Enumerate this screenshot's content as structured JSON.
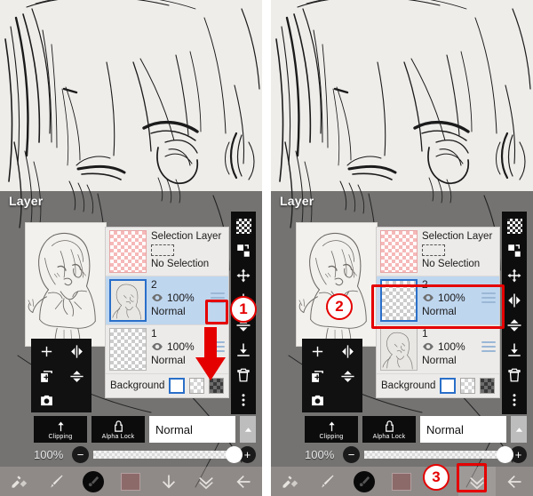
{
  "app": {
    "panel_title": "Layer"
  },
  "layer_panel": {
    "selection_layer": {
      "title": "Selection Layer",
      "status": "No Selection",
      "thumb": "pink-checker"
    },
    "rows_left": [
      {
        "name": "2",
        "opacity": "100%",
        "blend": "Normal",
        "selected": true,
        "thumb": "sketch"
      },
      {
        "name": "1",
        "opacity": "100%",
        "blend": "Normal",
        "selected": false,
        "thumb": "empty"
      }
    ],
    "rows_right": [
      {
        "name": "2",
        "opacity": "100%",
        "blend": "Normal",
        "selected": true,
        "thumb": "empty"
      },
      {
        "name": "1",
        "opacity": "100%",
        "blend": "Normal",
        "selected": false,
        "thumb": "sketch"
      }
    ],
    "background": {
      "label": "Background",
      "swatches": [
        "white",
        "light-checker",
        "dark-checker"
      ],
      "selected_index": 0
    }
  },
  "controls": {
    "clipping_label": "Clipping",
    "alpha_lock_label": "Alpha Lock",
    "blend_mode": "Normal",
    "opacity_value": "100%",
    "minus_label": "−",
    "plus_label": "+"
  },
  "tool_cluster": [
    "add-layer-icon",
    "flip-horizontal-icon",
    "duplicate-layer-icon",
    "flip-vertical-icon",
    "camera-icon"
  ],
  "vertical_strip": [
    "transparency-checker-icon",
    "duplicate-icon",
    "move-icon",
    "flip-horizontal-icon",
    "flip-vertical-icon",
    "merge-down-icon",
    "trash-icon",
    "more-options-icon"
  ],
  "bottom_bar": [
    "pen-eraser-icon",
    "brush-icon",
    "brush-size-circle",
    "color-swatch",
    "down-arrow-icon",
    "collapse-chevron-icon",
    "back-arrow-icon"
  ],
  "annotations": {
    "badge1": "1",
    "badge2": "2",
    "badge3": "3"
  },
  "colors": {
    "annotation_red": "#e50000",
    "selected_row_blue": "#bfd6ef",
    "selected_border_blue": "#2a6fc9",
    "panel_bg": "#edebe9",
    "color_swatch": "#8d6a6a"
  }
}
